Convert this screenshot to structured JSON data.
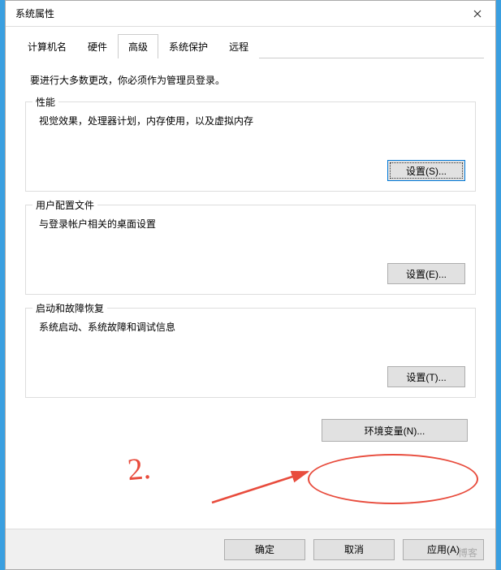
{
  "window": {
    "title": "系统属性"
  },
  "tabs": {
    "computer_name": "计算机名",
    "hardware": "硬件",
    "advanced": "高级",
    "system_protection": "系统保护",
    "remote": "远程"
  },
  "message": "要进行大多数更改，你必须作为管理员登录。",
  "groups": {
    "performance": {
      "title": "性能",
      "desc": "视觉效果，处理器计划，内存使用，以及虚拟内存",
      "button": "设置(S)..."
    },
    "user_profiles": {
      "title": "用户配置文件",
      "desc": "与登录帐户相关的桌面设置",
      "button": "设置(E)..."
    },
    "startup": {
      "title": "启动和故障恢复",
      "desc": "系统启动、系统故障和调试信息",
      "button": "设置(T)..."
    }
  },
  "env_button": "环境变量(N)...",
  "footer": {
    "ok": "确定",
    "cancel": "取消",
    "apply": "应用(A)"
  },
  "annotation": {
    "label": "2."
  },
  "watermark": "博客"
}
